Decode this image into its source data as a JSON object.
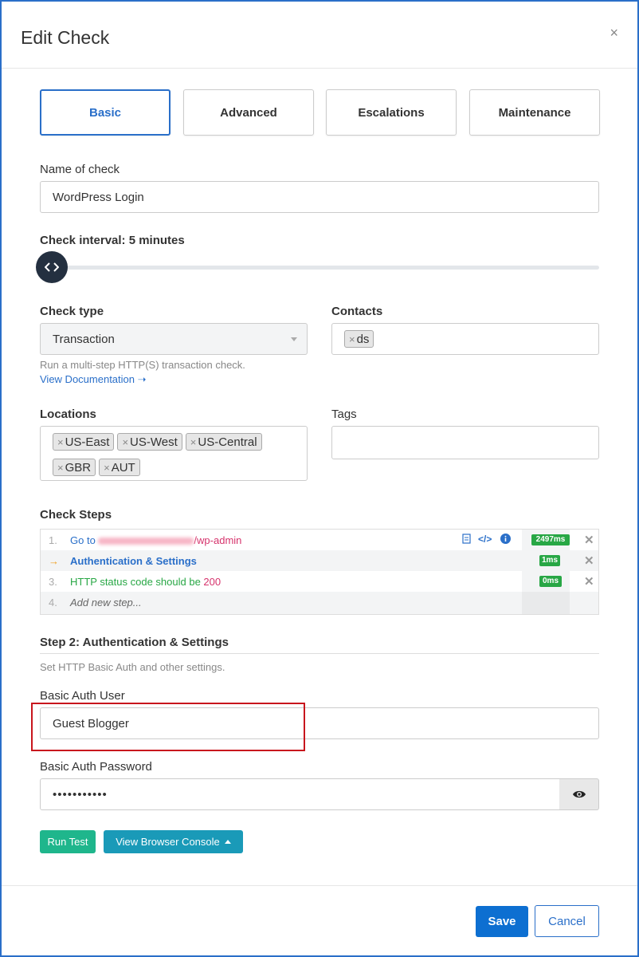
{
  "dialog": {
    "title": "Edit Check",
    "close_glyph": "×"
  },
  "tabs": [
    {
      "label": "Basic",
      "active": true
    },
    {
      "label": "Advanced",
      "active": false
    },
    {
      "label": "Escalations",
      "active": false
    },
    {
      "label": "Maintenance",
      "active": false
    }
  ],
  "name_field": {
    "label": "Name of check",
    "value": "WordPress Login"
  },
  "interval": {
    "label": "Check interval: 5 minutes",
    "knob_glyph": "‹ ›"
  },
  "check_type": {
    "label": "Check type",
    "value": "Transaction",
    "hint": "Run a multi-step HTTP(S) transaction check.",
    "doc_link": "View Documentation ➝"
  },
  "contacts": {
    "label": "Contacts",
    "chips": [
      "ds"
    ]
  },
  "locations": {
    "label": "Locations",
    "chips": [
      "US-East",
      "US-West",
      "US-Central",
      "GBR",
      "AUT"
    ]
  },
  "tags": {
    "label": "Tags",
    "value": ""
  },
  "check_steps": {
    "label": "Check Steps",
    "rows": [
      {
        "num": "1.",
        "prefix": "Go to ",
        "text": "/wp-admin",
        "time": "2497ms"
      },
      {
        "num": "→",
        "text": "Authentication & Settings",
        "time": "1ms"
      },
      {
        "num": "3.",
        "text": "HTTP status code should be ",
        "highlight": "200",
        "time": "0ms"
      },
      {
        "num": "4.",
        "text": "Add new step..."
      }
    ],
    "delete_glyph": "✕"
  },
  "step_detail": {
    "title": "Step 2: Authentication & Settings",
    "description": "Set HTTP Basic Auth and other settings.",
    "user_label": "Basic Auth User",
    "user_value": "Guest Blogger",
    "password_label": "Basic Auth Password",
    "password_value": "•••••••••••"
  },
  "actions": {
    "run_test": "Run Test",
    "view_console": "View Browser Console"
  },
  "footer": {
    "save": "Save",
    "cancel": "Cancel"
  },
  "colors": {
    "accent": "#2a6fc9",
    "run_test": "#1fb68c",
    "console": "#1a9ab8",
    "save": "#0d6fd1",
    "badge": "#28a745",
    "highlight_box": "#c8161d",
    "link_pink": "#d6336c",
    "step_green": "#28a745"
  }
}
